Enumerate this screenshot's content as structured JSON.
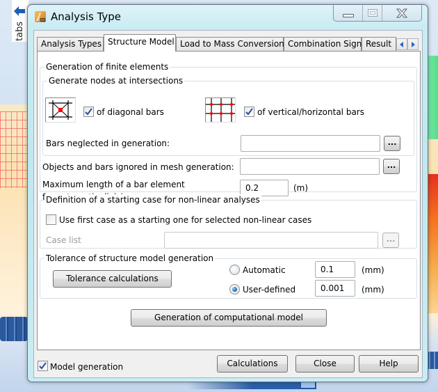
{
  "side_panel": {
    "label": "tabs",
    "arrow_icon": "arrow-left-icon"
  },
  "window": {
    "title": "Analysis Type",
    "app_icon": "robot-app-icon",
    "controls": {
      "minimize": "minimize-icon",
      "maximize": "maximize-icon",
      "close": "close-icon"
    }
  },
  "tabs": [
    {
      "label": "Analysis Types",
      "active": false
    },
    {
      "label": "Structure Model",
      "active": true
    },
    {
      "label": "Load to Mass Conversion",
      "active": false
    },
    {
      "label": "Combination Sign",
      "active": false
    },
    {
      "label": "Result",
      "active": false
    }
  ],
  "tab_scroll": {
    "left": "scroll-left-icon",
    "right": "scroll-right-icon"
  },
  "finite_elements": {
    "title": "Generation of finite elements",
    "nodes_group": {
      "title": "Generate nodes at intersections",
      "diagonal": {
        "label": "of diagonal bars",
        "checked": true,
        "icon": "diagonal-bars-icon"
      },
      "vertical_horizontal": {
        "label": "of vertical/horizontal bars",
        "checked": true,
        "icon": "grid-bars-icon"
      },
      "bars_neglected": {
        "label": "Bars neglected in generation:",
        "value": "",
        "button": "..."
      }
    },
    "objects_ignored": {
      "label": "Objects and bars ignored in mesh generation:",
      "value": "",
      "button": "..."
    },
    "max_length": {
      "label_line1": "Maximum length of a bar element",
      "label_line2": "for automatic division:",
      "value": "0.2",
      "unit": "(m)"
    }
  },
  "nonlinear": {
    "title": "Definition of a starting case for non-linear analyses",
    "use_first_case": {
      "label": "Use first case as a starting one for selected non-linear cases",
      "checked": false
    },
    "case_list": {
      "label": "Case list",
      "value": "",
      "button": "...",
      "enabled": false
    }
  },
  "tolerance": {
    "title": "Tolerance of structure model generation",
    "button": "Tolerance calculations",
    "automatic": {
      "label": "Automatic",
      "selected": false,
      "value": "0.1",
      "unit": "(mm)"
    },
    "user_defined": {
      "label": "User-defined",
      "selected": true,
      "value": "0.001",
      "unit": "(mm)"
    }
  },
  "generation_button": "Generation of computational model",
  "footer": {
    "model_generation": {
      "label": "Model generation",
      "checked": true
    },
    "calculations": "Calculations",
    "close": "Close",
    "help": "Help"
  }
}
